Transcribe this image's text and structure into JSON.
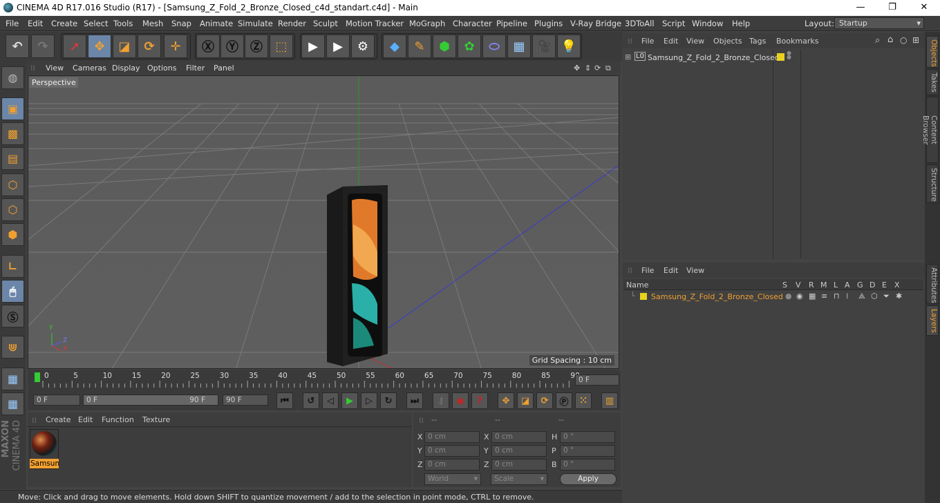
{
  "window": {
    "title": "CINEMA 4D R17.016 Studio (R17) - [Samsung_Z_Fold_2_Bronze_Closed_c4d_standart.c4d] - Main",
    "minimize": "—",
    "maximize": "❐",
    "close": "✕"
  },
  "menu": [
    "File",
    "Edit",
    "Create",
    "Select",
    "Tools",
    "Mesh",
    "Snap",
    "Animate",
    "Simulate",
    "Render",
    "Sculpt",
    "Motion Tracker",
    "MoGraph",
    "Character",
    "Pipeline",
    "Plugins",
    "V-Ray Bridge",
    "3DToAll",
    "Script",
    "Window",
    "Help"
  ],
  "layout": {
    "label": "Layout:",
    "value": "Startup"
  },
  "viewport": {
    "menu": [
      "View",
      "Cameras",
      "Display",
      "Options",
      "Filter",
      "Panel"
    ],
    "label": "Perspective",
    "grid_spacing": "Grid Spacing : 10 cm",
    "axis_y": "Y",
    "axis_z": "Z",
    "axis_x": "X"
  },
  "timeline": {
    "ticks": [
      "0",
      "5",
      "10",
      "15",
      "20",
      "25",
      "30",
      "35",
      "40",
      "45",
      "50",
      "55",
      "60",
      "65",
      "70",
      "75",
      "80",
      "85",
      "90"
    ],
    "current": "0 F"
  },
  "transport": {
    "start": "0 F",
    "range_start": "0 F",
    "range_end": "90 F",
    "end": "90 F"
  },
  "material": {
    "menu": [
      "Create",
      "Edit",
      "Function",
      "Texture"
    ],
    "item": "Samsun"
  },
  "coords": {
    "headers": [
      "--",
      "--",
      "--"
    ],
    "pos": [
      {
        "axis": "X",
        "value": "0 cm"
      },
      {
        "axis": "Y",
        "value": "0 cm"
      },
      {
        "axis": "Z",
        "value": "0 cm"
      }
    ],
    "size": [
      {
        "axis": "X",
        "value": "0 cm"
      },
      {
        "axis": "Y",
        "value": "0 cm"
      },
      {
        "axis": "Z",
        "value": "0 cm"
      }
    ],
    "rot": [
      {
        "axis": "H",
        "value": "0 °"
      },
      {
        "axis": "P",
        "value": "0 °"
      },
      {
        "axis": "B",
        "value": "0 °"
      }
    ],
    "mode": "World",
    "scale": "Scale",
    "apply": "Apply"
  },
  "status": "Move: Click and drag to move elements. Hold down SHIFT to quantize movement / add to the selection in point mode, CTRL to remove.",
  "objects": {
    "menu": [
      "File",
      "Edit",
      "View",
      "Objects",
      "Tags",
      "Bookmarks"
    ],
    "item": "Samsung_Z_Fold_2_Bronze_Closed",
    "item_icon": "L0"
  },
  "layers": {
    "menu": [
      "File",
      "Edit",
      "View"
    ],
    "columns": [
      "Name",
      "S",
      "V",
      "R",
      "M",
      "L",
      "A",
      "G",
      "D",
      "E",
      "X"
    ],
    "item": "Samsung_Z_Fold_2_Bronze_Closed"
  },
  "right_tabs": [
    "Objects",
    "Takes",
    "Content Browser",
    "Structure",
    "Attributes",
    "Layers"
  ],
  "brand": {
    "maxon": "MAXON",
    "cinema": "CINEMA 4D"
  },
  "colors": {
    "accent": "#f0a030",
    "active_tool": "#6b86a8",
    "layer_color": "#e8d21e"
  }
}
